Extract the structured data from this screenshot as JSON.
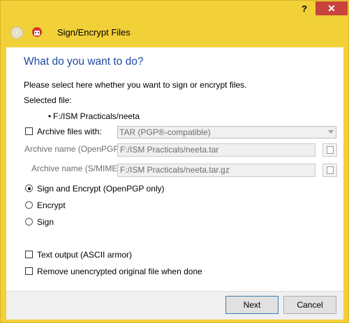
{
  "titlebar": {
    "help_label": "?",
    "close_label": "✕"
  },
  "header": {
    "title": "Sign/Encrypt Files"
  },
  "main": {
    "heading": "What do you want to do?",
    "instruction": "Please select here whether you want to sign or encrypt files.",
    "selected_file_label": "Selected file:",
    "selected_file": "F:/ISM Practicals/neeta",
    "archive_checkbox_label": "Archive files with:",
    "archive_checked": false,
    "archive_format": "TAR (PGP®-compatible)",
    "archive_name_openpgp_label": "Archive name (OpenPGP):",
    "archive_name_openpgp": "F:/ISM Practicals/neeta.tar",
    "archive_name_smime_label": "Archive name (S/MIME):",
    "archive_name_smime": "F:/ISM Practicals/neeta.tar.gz",
    "options": [
      {
        "label": "Sign and Encrypt (OpenPGP only)",
        "selected": true
      },
      {
        "label": "Encrypt",
        "selected": false
      },
      {
        "label": "Sign",
        "selected": false
      }
    ],
    "text_output_label": "Text output (ASCII armor)",
    "text_output_checked": false,
    "remove_original_label": "Remove unencrypted original file when done",
    "remove_original_checked": false
  },
  "footer": {
    "next_label": "Next",
    "cancel_label": "Cancel"
  },
  "colors": {
    "frame": "#f2d037",
    "heading": "#1d4aa5",
    "close": "#c7433b"
  }
}
